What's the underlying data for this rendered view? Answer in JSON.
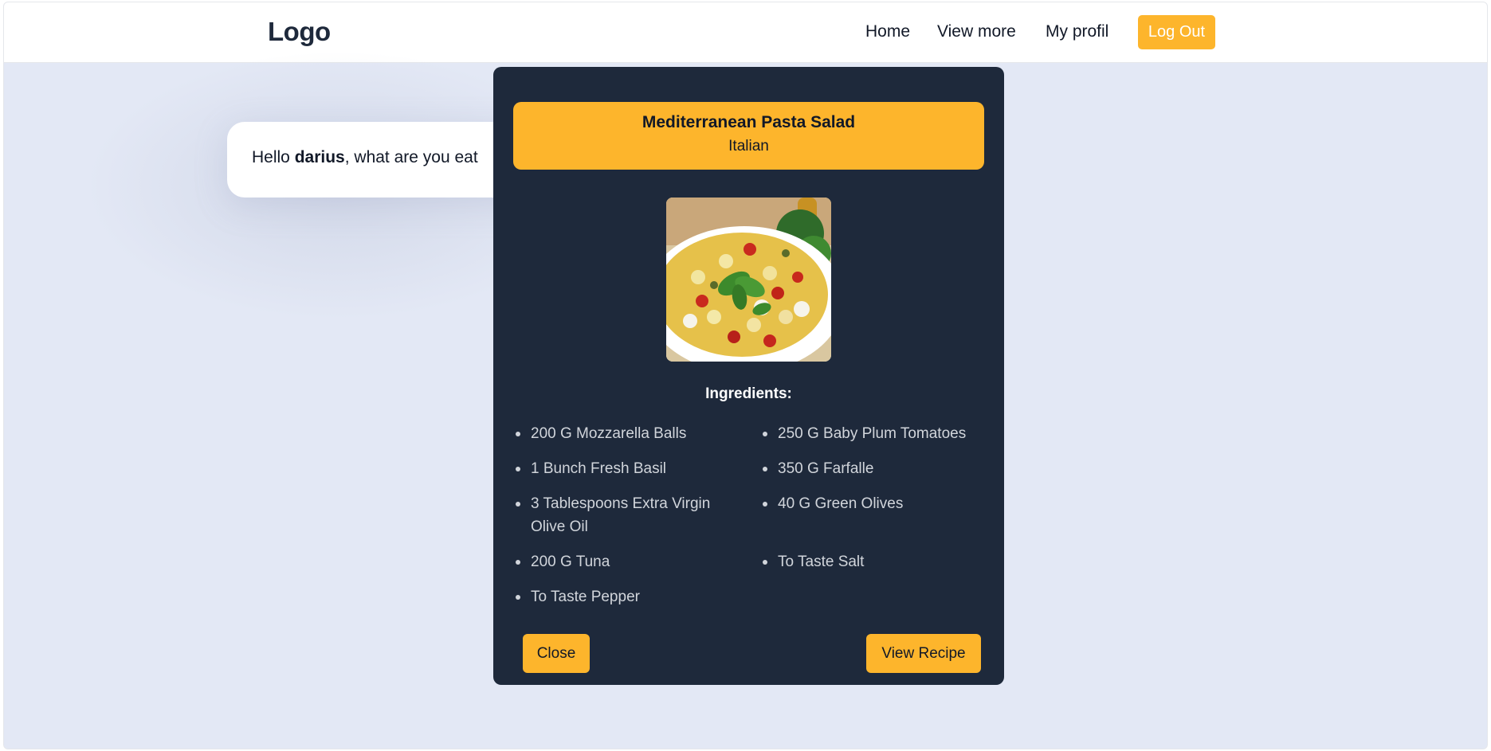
{
  "navbar": {
    "logo": "Logo",
    "links": [
      "Home",
      "View more",
      "My profil"
    ],
    "logout_label": "Log Out"
  },
  "greeting": {
    "prefix": "Hello ",
    "username": "darius",
    "suffix": ", what are you eat"
  },
  "modal": {
    "title": "Mediterranean Pasta Salad",
    "cuisine": "Italian",
    "image_icon": "pasta-salad-photo",
    "ingredients_heading": "Ingredients:",
    "ingredients": [
      "200 G Mozzarella Balls",
      "250 G Baby Plum Tomatoes",
      "1 Bunch Fresh Basil",
      "350 G Farfalle",
      "3 Tablespoons Extra Virgin Olive Oil",
      "40 G Green Olives",
      "200 G Tuna",
      "To Taste Salt",
      "To Taste Pepper"
    ],
    "close_label": "Close",
    "view_recipe_label": "View Recipe"
  },
  "colors": {
    "accent": "#fdb52c",
    "modal_bg": "#1e293b",
    "page_bg": "#e3e8f5"
  }
}
